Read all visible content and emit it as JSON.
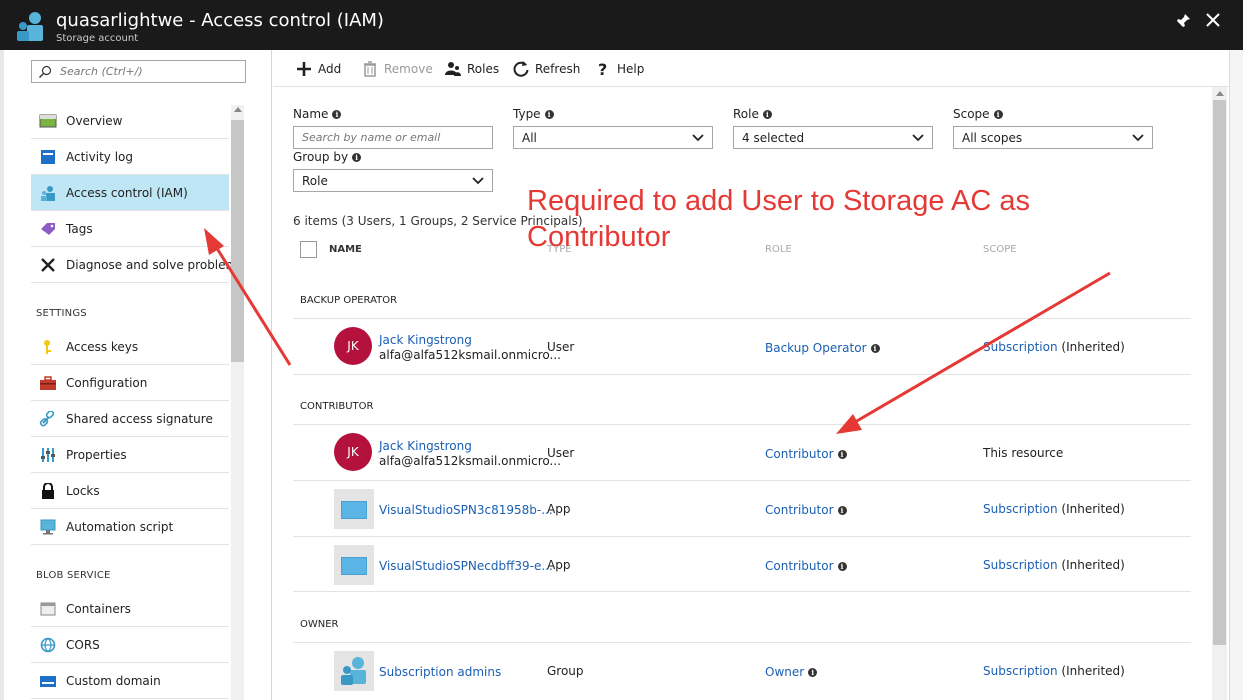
{
  "window": {
    "title": "quasarlightwe - Access control (IAM)",
    "subtitle": "Storage account"
  },
  "sidebar": {
    "search_placeholder": "Search (Ctrl+/)",
    "items": [
      {
        "label": "Overview",
        "icon": "overview-icon"
      },
      {
        "label": "Activity log",
        "icon": "activity-log-icon"
      },
      {
        "label": "Access control (IAM)",
        "icon": "iam-icon",
        "active": true
      },
      {
        "label": "Tags",
        "icon": "tag-icon"
      },
      {
        "label": "Diagnose and solve problems",
        "icon": "wrench-icon"
      }
    ],
    "settings_label": "SETTINGS",
    "settings_items": [
      {
        "label": "Access keys",
        "icon": "key-icon"
      },
      {
        "label": "Configuration",
        "icon": "toolbox-icon"
      },
      {
        "label": "Shared access signature",
        "icon": "link-icon"
      },
      {
        "label": "Properties",
        "icon": "sliders-icon"
      },
      {
        "label": "Locks",
        "icon": "lock-icon"
      },
      {
        "label": "Automation script",
        "icon": "monitor-icon"
      }
    ],
    "blob_label": "BLOB SERVICE",
    "blob_items": [
      {
        "label": "Containers",
        "icon": "containers-icon"
      },
      {
        "label": "CORS",
        "icon": "cors-icon"
      },
      {
        "label": "Custom domain",
        "icon": "domain-icon"
      }
    ]
  },
  "toolbar": {
    "add": "Add",
    "remove": "Remove",
    "roles": "Roles",
    "refresh": "Refresh",
    "help": "Help"
  },
  "filters": {
    "name_label": "Name",
    "name_placeholder": "Search by name or email",
    "type_label": "Type",
    "type_value": "All",
    "role_label": "Role",
    "role_value": "4 selected",
    "scope_label": "Scope",
    "scope_value": "All scopes",
    "groupby_label": "Group by",
    "groupby_value": "Role"
  },
  "table": {
    "count_text": "6 items (3 Users, 1 Groups, 2 Service Principals)",
    "columns": {
      "name": "NAME",
      "type": "TYPE",
      "role": "ROLE",
      "scope": "SCOPE"
    },
    "groups": [
      {
        "label": "BACKUP OPERATOR",
        "rows": [
          {
            "initials": "JK",
            "name": "Jack Kingstrong",
            "email": "alfa@alfa512ksmail.onmicro...",
            "type": "User",
            "role": "Backup Operator",
            "scope_link": "Subscription",
            "scope_suffix": "(Inherited)"
          }
        ]
      },
      {
        "label": "CONTRIBUTOR",
        "rows": [
          {
            "initials": "JK",
            "name": "Jack Kingstrong",
            "email": "alfa@alfa512ksmail.onmicro...",
            "type": "User",
            "role": "Contributor",
            "scope_plain": "This resource"
          },
          {
            "name": "VisualStudioSPN3c81958b-...",
            "type": "App",
            "role": "Contributor",
            "scope_link": "Subscription",
            "scope_suffix": "(Inherited)"
          },
          {
            "name": "VisualStudioSPNecdbff39-e...",
            "type": "App",
            "role": "Contributor",
            "scope_link": "Subscription",
            "scope_suffix": "(Inherited)"
          }
        ]
      },
      {
        "label": "OWNER",
        "rows": [
          {
            "name": "Subscription admins",
            "type": "Group",
            "role": "Owner",
            "scope_link": "Subscription",
            "scope_suffix": "(Inherited)"
          }
        ]
      }
    ]
  },
  "annotation": {
    "text": "Required to add User to Storage AC as Contributor",
    "color": "#e53935"
  },
  "colors": {
    "titlebar": "#1a1a1a",
    "active_nav": "#bfe6f5",
    "link": "#1b5fb3",
    "avatar": "#b4123c"
  }
}
